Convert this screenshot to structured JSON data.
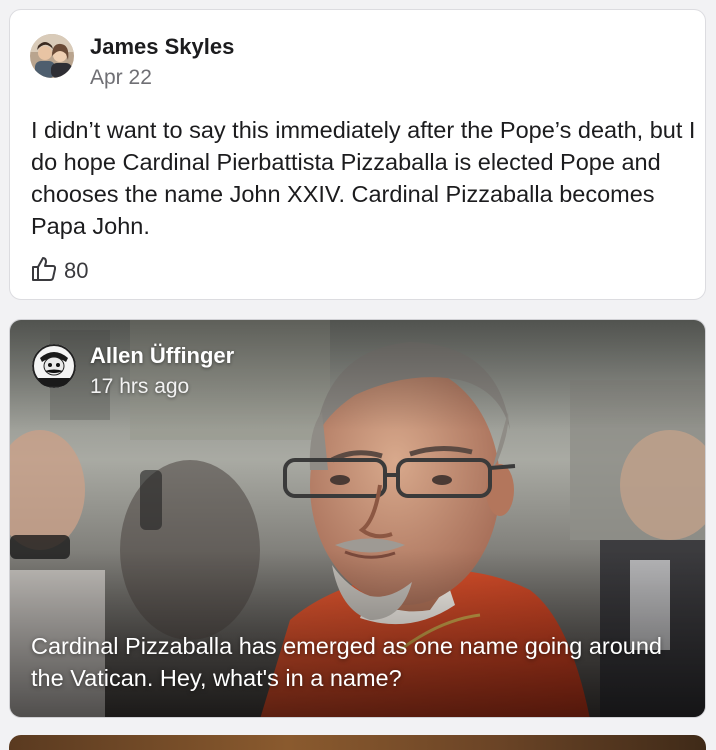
{
  "posts": [
    {
      "author": "James Skyles",
      "time": "Apr 22",
      "body": "I didn’t want to say this immediately after the Pope’s death, but I do hope Cardinal Pierbattista Pizzaballa is elected Pope and chooses the name John XXIV. Cardinal Pizzaballa becomes Papa John.",
      "likes": "80"
    },
    {
      "author": "Allen Üffinger",
      "time": "17 hrs ago",
      "caption": "Cardinal Pizzaballa has emerged as one name going around the Vatican. Hey, what's in a name?"
    }
  ],
  "icons": {
    "like": "thumbs-up-icon"
  },
  "colors": {
    "card_bg": "#ffffff",
    "page_bg": "#f2f2f4",
    "text": "#1c1c1e",
    "muted": "#6f6f74"
  }
}
